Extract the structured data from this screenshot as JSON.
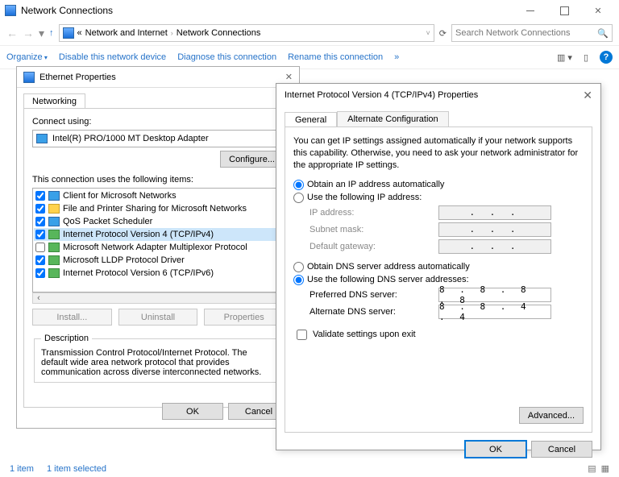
{
  "explorer": {
    "title": "Network Connections",
    "address_prefix": "«",
    "address_seg1": "Network and Internet",
    "address_seg2": "Network Connections",
    "search_placeholder": "Search Network Connections",
    "cmds": {
      "organize": "Organize",
      "disable": "Disable this network device",
      "diagnose": "Diagnose this connection",
      "rename": "Rename this connection",
      "more": "»"
    },
    "status_item": "1 item",
    "status_sel": "1 item selected"
  },
  "ethdlg": {
    "title": "Ethernet Properties",
    "tab_networking": "Networking",
    "connect_using": "Connect using:",
    "adapter": "Intel(R) PRO/1000 MT Desktop Adapter",
    "configure": "Configure...",
    "uses_label": "This connection uses the following items:",
    "items": [
      {
        "checked": true,
        "icon": "blue",
        "label": "Client for Microsoft Networks"
      },
      {
        "checked": true,
        "icon": "yellow",
        "label": "File and Printer Sharing for Microsoft Networks"
      },
      {
        "checked": true,
        "icon": "blue",
        "label": "QoS Packet Scheduler"
      },
      {
        "checked": true,
        "icon": "green",
        "label": "Internet Protocol Version 4 (TCP/IPv4)",
        "selected": true
      },
      {
        "checked": false,
        "icon": "green",
        "label": "Microsoft Network Adapter Multiplexor Protocol"
      },
      {
        "checked": true,
        "icon": "green",
        "label": "Microsoft LLDP Protocol Driver"
      },
      {
        "checked": true,
        "icon": "green",
        "label": "Internet Protocol Version 6 (TCP/IPv6)"
      }
    ],
    "install": "Install...",
    "uninstall": "Uninstall",
    "properties": "Properties",
    "desc_header": "Description",
    "desc_text": "Transmission Control Protocol/Internet Protocol. The default wide area network protocol that provides communication across diverse interconnected networks.",
    "ok": "OK",
    "cancel": "Cancel"
  },
  "ipdlg": {
    "title": "Internet Protocol Version 4 (TCP/IPv4) Properties",
    "tab_general": "General",
    "tab_alt": "Alternate Configuration",
    "explain": "You can get IP settings assigned automatically if your network supports this capability. Otherwise, you need to ask your network administrator for the appropriate IP settings.",
    "opt_auto_ip": "Obtain an IP address automatically",
    "opt_manual_ip": "Use the following IP address:",
    "lbl_ip": "IP address:",
    "lbl_mask": "Subnet mask:",
    "lbl_gw": "Default gateway:",
    "opt_auto_dns": "Obtain DNS server address automatically",
    "opt_manual_dns": "Use the following DNS server addresses:",
    "lbl_dns1": "Preferred DNS server:",
    "lbl_dns2": "Alternate DNS server:",
    "val_dns1": "8 . 8 . 8 . 8",
    "val_dns2": "8 . 8 . 4 . 4",
    "validate": "Validate settings upon exit",
    "advanced": "Advanced...",
    "ok": "OK",
    "cancel": "Cancel"
  }
}
